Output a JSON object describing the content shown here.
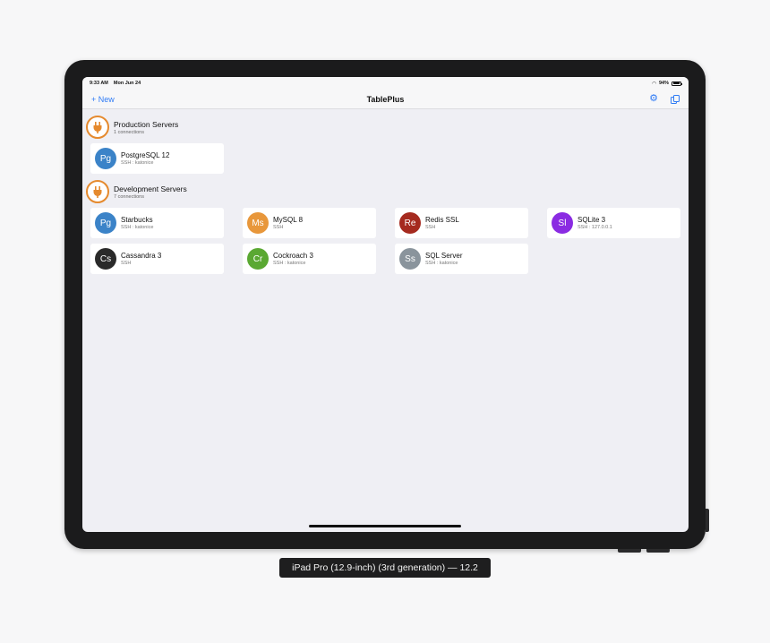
{
  "status": {
    "time": "9:33 AM",
    "date": "Mon Jun 24",
    "battery": "94%",
    "battery_level": 0.94
  },
  "nav": {
    "new_label": "+ New",
    "title": "TablePlus",
    "settings_icon": "gear-icon",
    "windows_icon": "windows-icon"
  },
  "groups": [
    {
      "name": "Production Servers",
      "count": "1 connections",
      "icon": "plug-icon",
      "connections": [
        {
          "initials": "Pg",
          "name": "PostgreSQL 12",
          "detail": "SSH : katonice",
          "color": "#3b83c8"
        }
      ]
    },
    {
      "name": "Development Servers",
      "count": "7 connections",
      "icon": "plug-icon",
      "connections": [
        {
          "initials": "Pg",
          "name": "Starbucks",
          "detail": "SSH : katonice",
          "color": "#3b83c8"
        },
        {
          "initials": "Ms",
          "name": "MySQL 8",
          "detail": "SSH",
          "color": "#e8973b"
        },
        {
          "initials": "Re",
          "name": "Redis SSL",
          "detail": "SSH",
          "color": "#a52a1f"
        },
        {
          "initials": "Sl",
          "name": "SQLite 3",
          "detail": "SSH : 127.0.0.1",
          "color": "#8a2be2"
        },
        {
          "initials": "Cs",
          "name": "Cassandra 3",
          "detail": "SSH",
          "color": "#2a2a2a"
        },
        {
          "initials": "Cr",
          "name": "Cockroach 3",
          "detail": "SSH : katonice",
          "color": "#5aa832"
        },
        {
          "initials": "Ss",
          "name": "SQL Server",
          "detail": "SSH : katonice",
          "color": "#8a949c"
        }
      ]
    }
  ],
  "caption": "iPad Pro (12.9-inch) (3rd generation) — 12.2"
}
